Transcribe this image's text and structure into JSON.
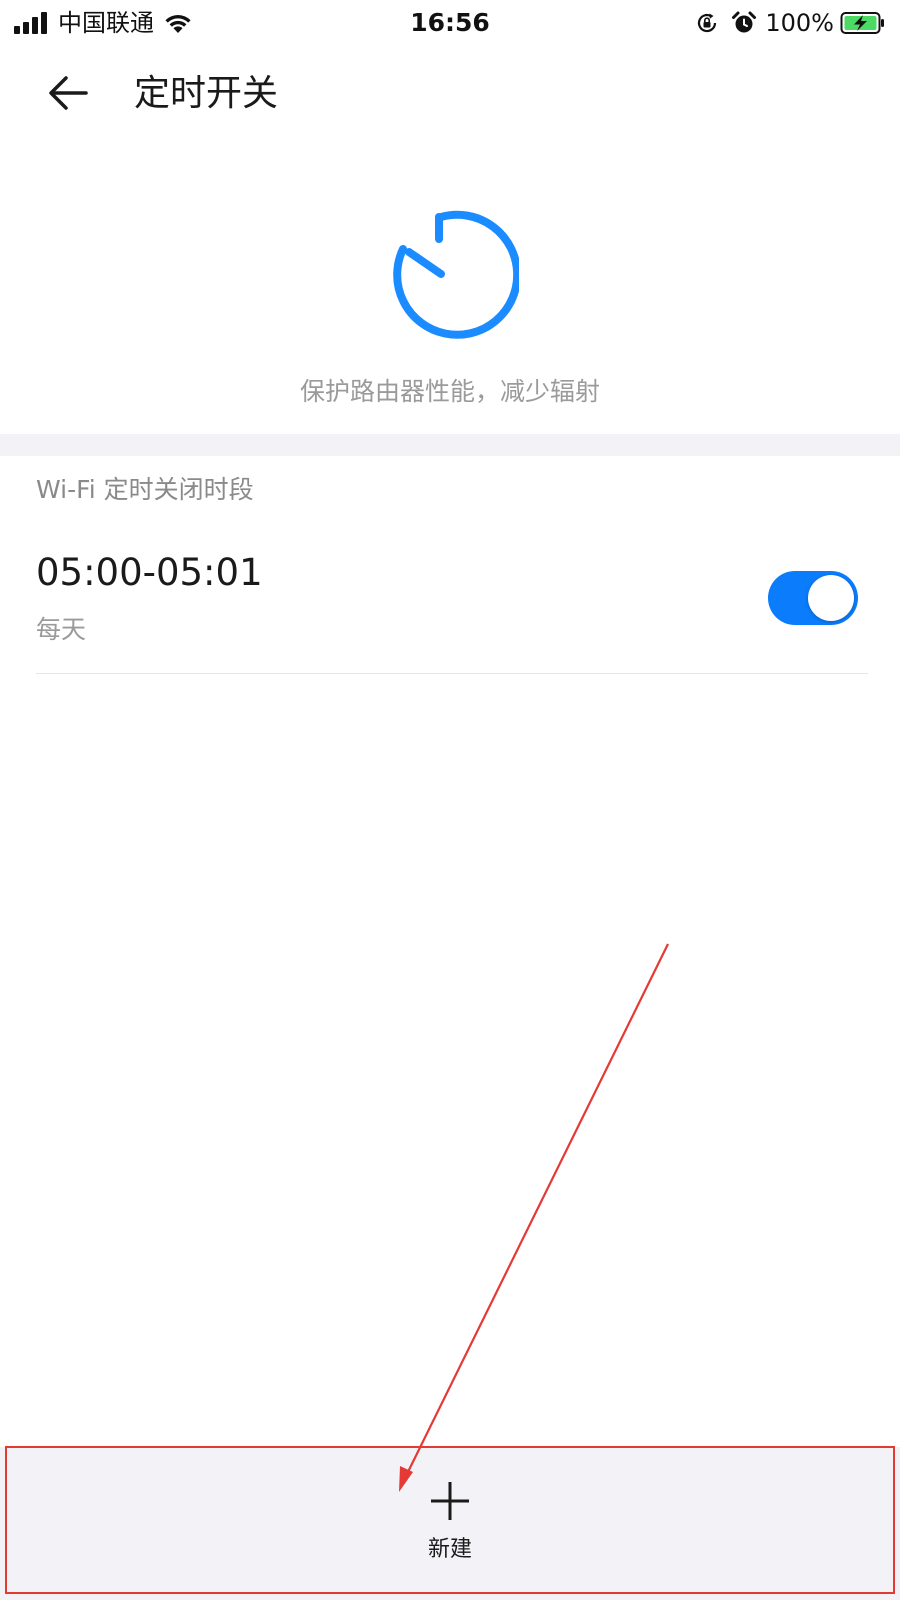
{
  "status_bar": {
    "carrier": "中国联通",
    "time": "16:56",
    "battery_percent": "100%",
    "icons": [
      "signal-icon",
      "wifi-icon",
      "rotation-lock-icon",
      "alarm-icon",
      "battery-charging-icon"
    ]
  },
  "nav": {
    "back_icon": "back-arrow-icon",
    "title": "定时开关"
  },
  "hero": {
    "icon": "timer-icon",
    "subtitle": "保护路由器性能，减少辐射",
    "accent_color": "#1a8cff"
  },
  "section": {
    "header": "Wi-Fi 定时关闭时段"
  },
  "schedules": [
    {
      "time_range": "05:00-05:01",
      "repeat": "每天",
      "enabled": true
    }
  ],
  "toggle_color": "#0a7cfc",
  "bottom_bar": {
    "new_icon": "plus-icon",
    "new_label": "新建"
  },
  "annotation_color": "#e53935"
}
